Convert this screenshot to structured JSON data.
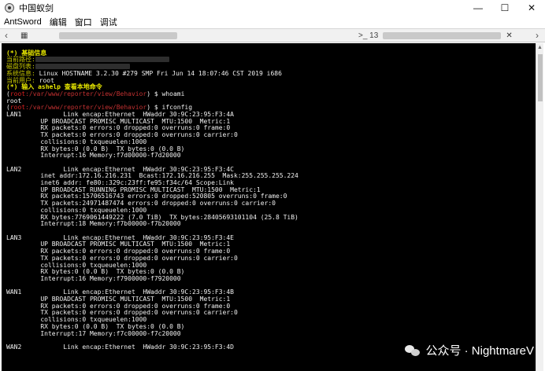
{
  "window": {
    "title": "中国蚁剑",
    "controls": {
      "minimize": "—",
      "maximize": "☐",
      "close": "✕"
    },
    "app_icon": "antsword-logo-icon"
  },
  "menu": [
    "AntSword",
    "编辑",
    "窗口",
    "调试"
  ],
  "tabs": {
    "home_icon": "grid-icon",
    "second_tab_prefix": ">_ 13",
    "close": "✕"
  },
  "terminal": {
    "header": {
      "title": "(*) 基础信息",
      "path_label": "当前路径:",
      "disk_label": "磁盘列表:",
      "sys_label": "系统信息:",
      "sys_value": " Linux HOSTNAME 3.2.30 #279 SMP Fri Jun 14 18:07:46 CST 2019 i686",
      "user_label": "当前用户:",
      "user_value": " root",
      "help": "(*) 输入 ashelp 查看本地命令"
    },
    "prompt1": {
      "user": "root",
      "path": ":/var/www/reporter/view/Behavior",
      "cmd": " $ whoami",
      "output": "root"
    },
    "prompt2": {
      "user": "root",
      "path": ":/var/www/reporter/view/Behavior",
      "cmd": " $ ifconfig"
    },
    "ifconfig_lines": [
      "LAN1           Link encap:Ethernet  HWaddr 30:9C:23:95:F3:4A",
      "         UP BROADCAST PROMISC MULTICAST  MTU:1500  Metric:1",
      "         RX packets:0 errors:0 dropped:0 overruns:0 frame:0",
      "         TX packets:0 errors:0 dropped:0 overruns:0 carrier:0",
      "         collisions:0 txqueuelen:1000",
      "         RX bytes:0 (0.0 B)  TX bytes:0 (0.0 B)",
      "         Interrupt:16 Memory:f7d00000-f7d20000",
      "",
      "LAN2           Link encap:Ethernet  HWaddr 30:9C:23:95:F3:4C",
      "         inet addr:172.16.216.231  Bcast:172.16.216.255  Mask:255.255.255.224",
      "         inet6 addr: fe80::329c:23ff:fe95:f34c/64 Scope:Link",
      "         UP BROADCAST RUNNING PROMISC MULTICAST  MTU:1500  Metric:1",
      "         RX packets:15706516743 errors:0 dropped:520805 overruns:0 frame:0",
      "         TX packets:24971487474 errors:0 dropped:0 overruns:0 carrier:0",
      "         collisions:0 txqueuelen:1000",
      "         RX bytes:7769061449222 (7.0 TiB)  TX bytes:28405693101104 (25.8 TiB)",
      "         Interrupt:18 Memory:f7b00000-f7b20000",
      "",
      "LAN3           Link encap:Ethernet  HWaddr 30:9C:23:95:F3:4E",
      "         UP BROADCAST PROMISC MULTICAST  MTU:1500  Metric:1",
      "         RX packets:0 errors:0 dropped:0 overruns:0 frame:0",
      "         TX packets:0 errors:0 dropped:0 overruns:0 carrier:0",
      "         collisions:0 txqueuelen:1000",
      "         RX bytes:0 (0.0 B)  TX bytes:0 (0.0 B)",
      "         Interrupt:16 Memory:f7900000-f7920000",
      "",
      "WAN1           Link encap:Ethernet  HWaddr 30:9C:23:95:F3:4B",
      "         UP BROADCAST PROMISC MULTICAST  MTU:1500  Metric:1",
      "         RX packets:0 errors:0 dropped:0 overruns:0 frame:0",
      "         TX packets:0 errors:0 dropped:0 overruns:0 carrier:0",
      "         collisions:0 txqueuelen:1000",
      "         RX bytes:0 (0.0 B)  TX bytes:0 (0.0 B)",
      "         Interrupt:17 Memory:f7c00000-f7c20000",
      "",
      "WAN2           Link encap:Ethernet  HWaddr 30:9C:23:95:F3:4D"
    ]
  },
  "watermark": {
    "text": "公众号 · NightmareV",
    "icon": "wechat-icon"
  }
}
